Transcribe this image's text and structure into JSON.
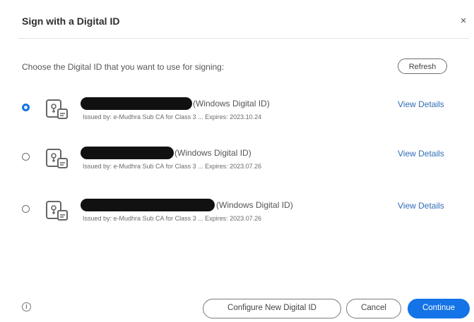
{
  "dialog": {
    "title": "Sign with a Digital ID",
    "close_label": "×",
    "instruction": "Choose the Digital ID that you want to use for signing:",
    "refresh_label": "Refresh"
  },
  "digital_ids": [
    {
      "name": "",
      "type": "(Windows Digital ID)",
      "issuer": "Issued by: e-Mudhra Sub CA for Class 3 ... Expires: 2023.10.24",
      "selected": true,
      "view_details_label": "View Details"
    },
    {
      "name": "",
      "type": "(Windows Digital ID)",
      "issuer": "Issued by: e-Mudhra Sub CA for Class 3 ... Expires: 2023.07.26",
      "selected": false,
      "view_details_label": "View Details"
    },
    {
      "name": "",
      "type": "(Windows Digital ID)",
      "issuer": "Issued by: e-Mudhra Sub CA for Class 3 ... Expires: 2023.07.26",
      "selected": false,
      "view_details_label": "View Details"
    }
  ],
  "footer": {
    "info_icon": "info-icon",
    "info_glyph": "i",
    "configure_label": "Configure New Digital ID",
    "cancel_label": "Cancel",
    "continue_label": "Continue"
  },
  "colors": {
    "accent": "#1473e6",
    "link": "#2f6db5"
  }
}
